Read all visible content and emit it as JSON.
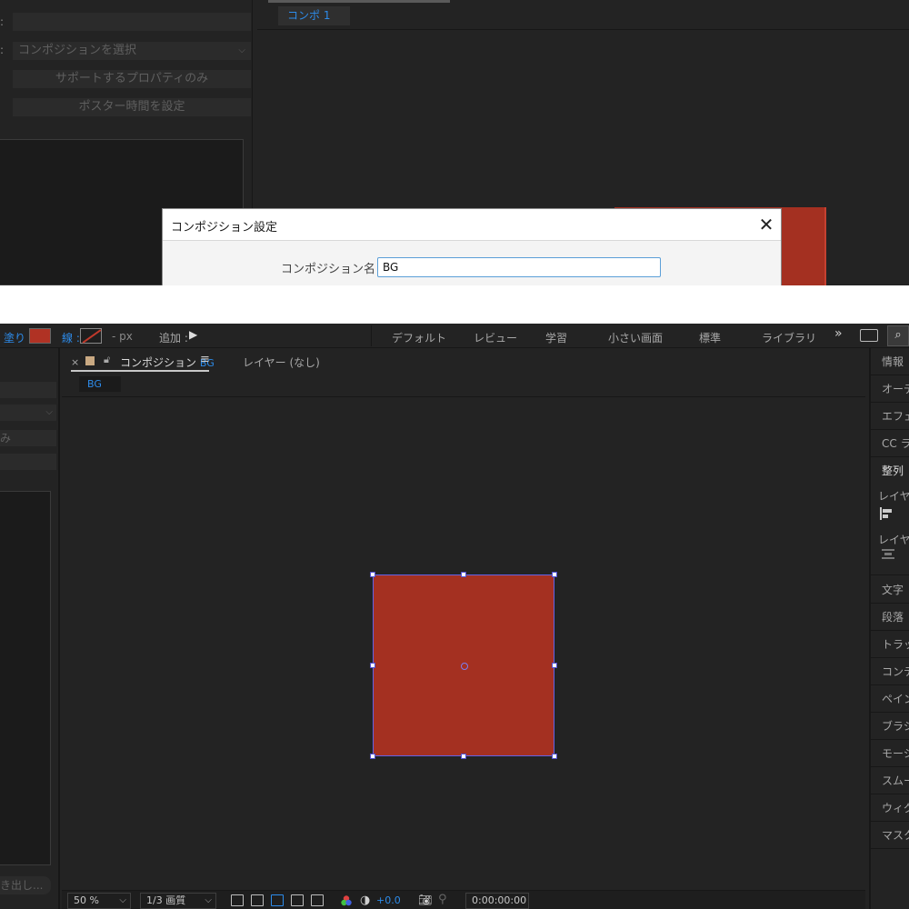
{
  "top": {
    "left_rows": [
      "",
      "コンポジションを選択",
      "サポートするプロパティのみ",
      "ポスター時間を設定"
    ],
    "row_colon": ":",
    "comp_tab": "コンポ 1",
    "dialog": {
      "title": "コンポジション設定",
      "close": "✕",
      "comp_name_label": "コンポジション名 :",
      "comp_name_value": "BG"
    }
  },
  "toolbar": {
    "fill_label": "塗り :",
    "stroke_label": "線 :",
    "stroke_width": "- px",
    "add_label": "追加 :",
    "workspaces": [
      "デフォルト",
      "レビュー",
      "学習",
      "小さい画面",
      "標準",
      "ライブラリ"
    ],
    "more": "»"
  },
  "left_panel": {
    "rows": [
      "",
      "",
      "み",
      ""
    ],
    "footer": "き出し..."
  },
  "comp_panel": {
    "tab_prefix": "コンポジション",
    "tab_name": "BG",
    "menu": "≡",
    "close": "×",
    "layer_tab": "レイヤー (なし)",
    "chip": "BG",
    "footer": {
      "zoom": "50 %",
      "resolution": "1/3 画質",
      "exposure": "+0.0",
      "timecode": "0:00:00:00"
    }
  },
  "right_panel": {
    "items": [
      "情報",
      "オーディオ",
      "エフェクト",
      "CC ライブラリ",
      "整列",
      "文字",
      "段落",
      "トラッカー",
      "コンテンツ",
      "ペイント",
      "ブラシ",
      "モーション",
      "スムーザー",
      "ウィグラー",
      "マスク補間"
    ],
    "align_sub1": "レイヤー",
    "align_sub2": "レイヤー"
  },
  "colors": {
    "fill": "#b03224",
    "shape": "#a43021",
    "accent_blue": "#2d8ceb",
    "bounding_box": "#6262e8"
  }
}
